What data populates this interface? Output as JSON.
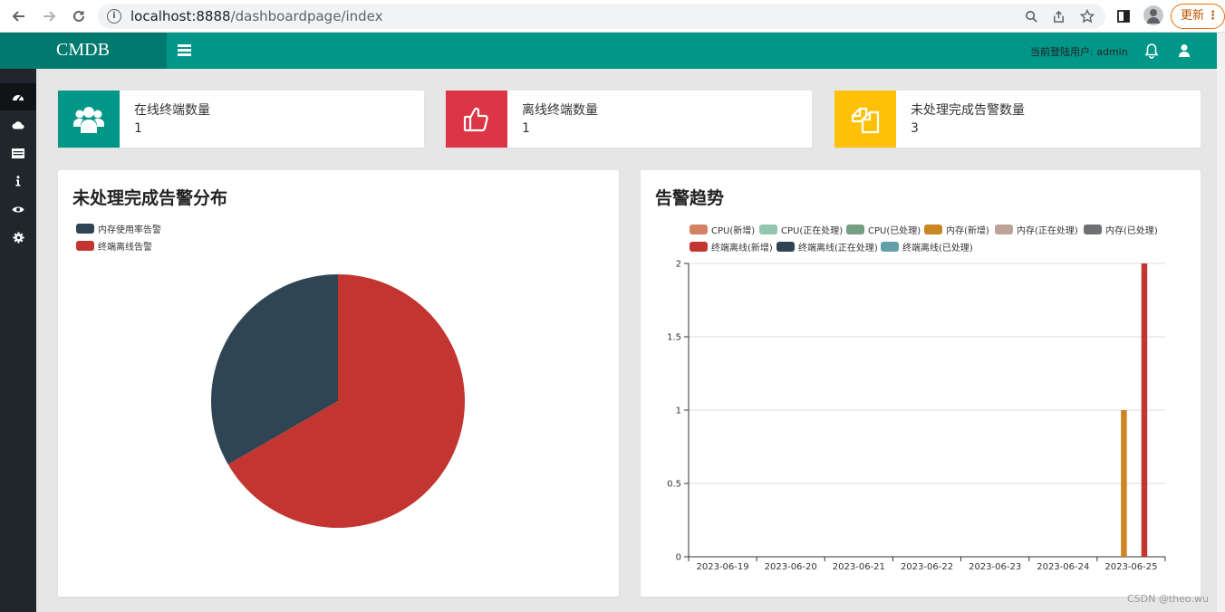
{
  "browser": {
    "url_host": "localhost:8888",
    "url_path": "/dashboardpage/index",
    "update_label": "更新"
  },
  "header": {
    "logo": "CMDB",
    "user_label": "当前登陆用户: admin"
  },
  "sidebar": {
    "items": [
      {
        "icon": "dashboard-icon",
        "active": true
      },
      {
        "icon": "cloud-icon",
        "active": false
      },
      {
        "icon": "list-icon",
        "active": false
      },
      {
        "icon": "info-icon",
        "active": false
      },
      {
        "icon": "eye-icon",
        "active": false
      },
      {
        "icon": "gear-icon",
        "active": false
      }
    ]
  },
  "stats": [
    {
      "label": "在线终端数量",
      "value": "1",
      "color": "#009688",
      "icon": "users-icon"
    },
    {
      "label": "离线终端数量",
      "value": "1",
      "color": "#dc3545",
      "icon": "thumbs-up-icon"
    },
    {
      "label": "未处理完成告警数量",
      "value": "3",
      "color": "#ffc107",
      "icon": "copy-icon"
    }
  ],
  "pie_panel": {
    "title": "未处理完成告警分布"
  },
  "bar_panel": {
    "title": "告警趋势"
  },
  "watermark": "CSDN @theo.wu",
  "chart_data": [
    {
      "type": "pie",
      "slices": [
        {
          "name": "内存使用率告警",
          "value": 1,
          "color": "#2f4554"
        },
        {
          "name": "终端离线告警",
          "value": 2,
          "color": "#c23531"
        }
      ]
    },
    {
      "type": "bar",
      "categories": [
        "2023-06-19",
        "2023-06-20",
        "2023-06-21",
        "2023-06-22",
        "2023-06-23",
        "2023-06-24",
        "2023-06-25"
      ],
      "ylim": [
        0,
        2
      ],
      "yticks": [
        "0",
        "0.5",
        "1",
        "1.5",
        "2"
      ],
      "grid": true,
      "legend_position": "top",
      "series": [
        {
          "name": "CPU(新增)",
          "color": "#d48265",
          "values": [
            0,
            0,
            0,
            0,
            0,
            0,
            0
          ]
        },
        {
          "name": "CPU(正在处理)",
          "color": "#91c7ae",
          "values": [
            0,
            0,
            0,
            0,
            0,
            0,
            0
          ]
        },
        {
          "name": "CPU(已处理)",
          "color": "#749f83",
          "values": [
            0,
            0,
            0,
            0,
            0,
            0,
            0
          ]
        },
        {
          "name": "内存(新增)",
          "color": "#ca8622",
          "values": [
            0,
            0,
            0,
            0,
            0,
            0,
            1
          ]
        },
        {
          "name": "内存(正在处理)",
          "color": "#bda29a",
          "values": [
            0,
            0,
            0,
            0,
            0,
            0,
            0
          ]
        },
        {
          "name": "内存(已处理)",
          "color": "#6e7074",
          "values": [
            0,
            0,
            0,
            0,
            0,
            0,
            0
          ]
        },
        {
          "name": "终端离线(新增)",
          "color": "#c23531",
          "values": [
            0,
            0,
            0,
            0,
            0,
            0,
            2
          ]
        },
        {
          "name": "终端离线(正在处理)",
          "color": "#2f4554",
          "values": [
            0,
            0,
            0,
            0,
            0,
            0,
            0
          ]
        },
        {
          "name": "终端离线(已处理)",
          "color": "#61a0a8",
          "values": [
            0,
            0,
            0,
            0,
            0,
            0,
            0
          ]
        }
      ]
    }
  ]
}
